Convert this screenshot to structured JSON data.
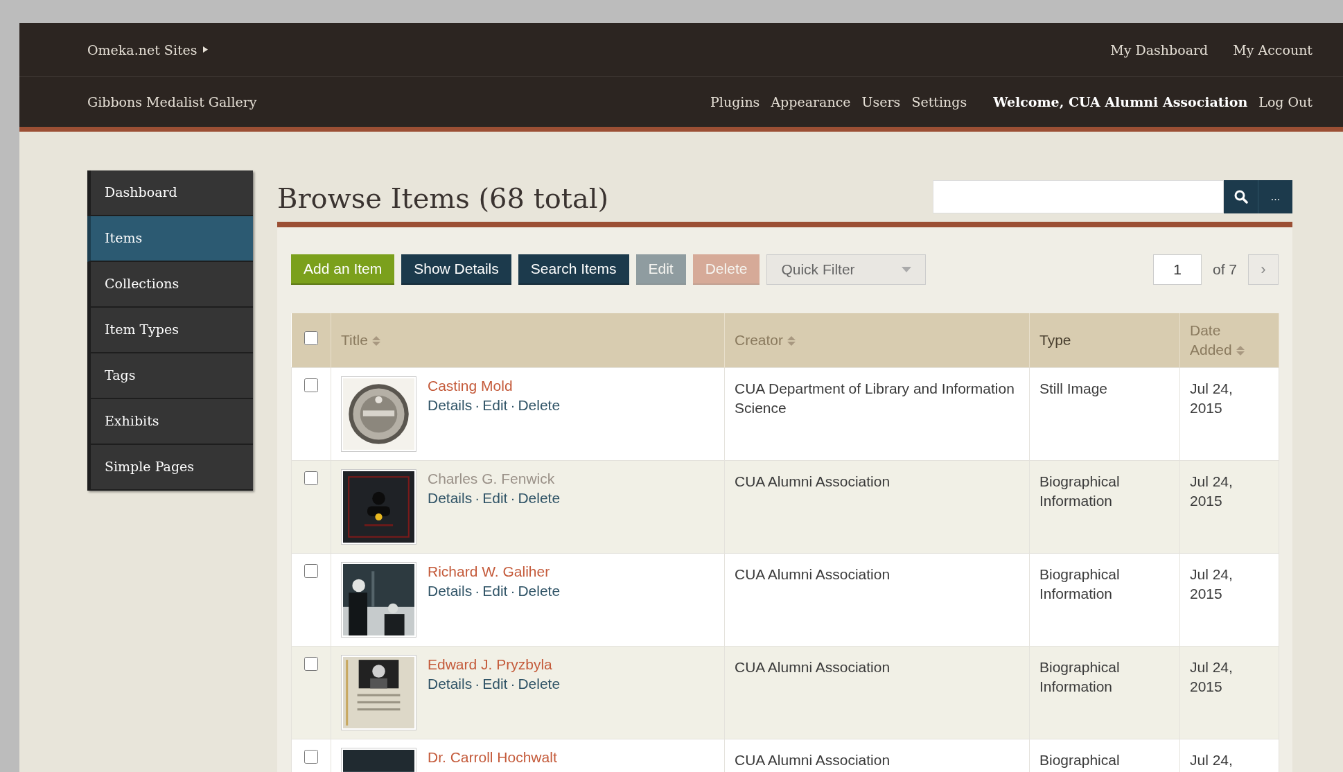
{
  "top_bar": {
    "sites_menu": "Omeka.net Sites",
    "links": [
      "My Dashboard",
      "My Account"
    ]
  },
  "admin_bar": {
    "site_title": "Gibbons Medalist Gallery",
    "nav": [
      "Plugins",
      "Appearance",
      "Users",
      "Settings"
    ],
    "welcome": "Welcome, CUA Alumni Association",
    "logout": "Log Out"
  },
  "sidebar": {
    "items": [
      {
        "label": "Dashboard",
        "selected": false
      },
      {
        "label": "Items",
        "selected": true
      },
      {
        "label": "Collections",
        "selected": false
      },
      {
        "label": "Item Types",
        "selected": false
      },
      {
        "label": "Tags",
        "selected": false
      },
      {
        "label": "Exhibits",
        "selected": false
      },
      {
        "label": "Simple Pages",
        "selected": false
      }
    ]
  },
  "page_title": "Browse Items (68 total)",
  "search": {
    "more_button": "..."
  },
  "toolbar": {
    "buttons": [
      {
        "label": "Add an Item",
        "kind": "add",
        "disabled": false
      },
      {
        "label": "Show Details",
        "kind": "action",
        "disabled": false
      },
      {
        "label": "Search Items",
        "kind": "action",
        "disabled": false
      },
      {
        "label": "Edit",
        "kind": "action",
        "disabled": true
      },
      {
        "label": "Delete",
        "kind": "danger",
        "disabled": true
      }
    ],
    "quick_filter": "Quick Filter",
    "pagination": {
      "page": "1",
      "of": "of 7",
      "next": "›"
    }
  },
  "table": {
    "select_all_checked": false,
    "columns": [
      {
        "label": "Title",
        "sortable": true
      },
      {
        "label": "Creator",
        "sortable": true
      },
      {
        "label": "Type",
        "sortable": false
      },
      {
        "label": "Date Added",
        "sortable": true
      }
    ],
    "rows": [
      {
        "checked": false,
        "title": "Casting Mold",
        "hovered": false,
        "actions": [
          "Details",
          "Edit",
          "Delete"
        ],
        "separators": [
          "·",
          "·"
        ],
        "creator": "CUA Department of Library and Information Science",
        "type": "Still Image",
        "date": "Jul 24, 2015"
      },
      {
        "checked": false,
        "title": "Charles G. Fenwick",
        "hovered": true,
        "actions": [
          "Details",
          "Edit",
          "Delete"
        ],
        "separators": [
          "·",
          "·"
        ],
        "creator": "CUA Alumni Association",
        "type": "Biographical Information",
        "date": "Jul 24, 2015"
      },
      {
        "checked": false,
        "title": "Richard W. Galiher",
        "hovered": false,
        "actions": [
          "Details",
          "Edit",
          "Delete"
        ],
        "separators": [
          "·",
          "·"
        ],
        "creator": "CUA Alumni Association",
        "type": "Biographical Information",
        "date": "Jul 24, 2015"
      },
      {
        "checked": false,
        "title": "Edward J. Pryzbyla",
        "hovered": false,
        "actions": [
          "Details",
          "Edit",
          "Delete"
        ],
        "separators": [
          "·",
          "·"
        ],
        "creator": "CUA Alumni Association",
        "type": "Biographical Information",
        "date": "Jul 24, 2015"
      },
      {
        "checked": false,
        "title": "Dr. Carroll Hochwalt",
        "hovered": false,
        "creator": "CUA Alumni Association",
        "type": "Biographical",
        "date": "Jul 24,"
      }
    ]
  }
}
